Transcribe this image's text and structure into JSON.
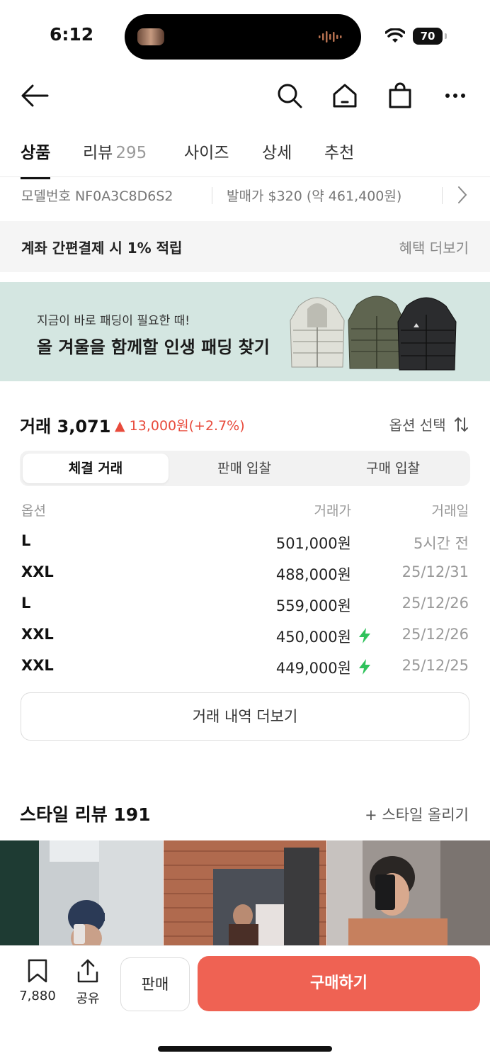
{
  "status": {
    "time": "6:12",
    "battery": "70"
  },
  "tabs": [
    {
      "label": "상품"
    },
    {
      "label": "리뷰",
      "count": "295"
    },
    {
      "label": "사이즈"
    },
    {
      "label": "상세"
    },
    {
      "label": "추천"
    }
  ],
  "model": {
    "number": "모델번호 NF0A3C8D6S2",
    "release": "발매가 $320 (약 461,400원)"
  },
  "benefit": {
    "text": "계좌 간편결제 시 1% 적립",
    "more": "혜택 더보기"
  },
  "banner": {
    "sub": "지금이 바로 패딩이 필요한 때!",
    "main": "올 겨울을 함께할 인생 패딩 찾기"
  },
  "trade": {
    "title": "거래 3,071",
    "change": "▲ 13,000원(+2.7%)",
    "option_select": "옵션 선택",
    "segments": [
      "체결 거래",
      "판매 입찰",
      "구매 입찰"
    ],
    "columns": [
      "옵션",
      "거래가",
      "거래일"
    ],
    "rows": [
      {
        "option": "L",
        "price": "501,000원",
        "date": "5시간 전",
        "quick": false
      },
      {
        "option": "XXL",
        "price": "488,000원",
        "date": "25/12/31",
        "quick": false
      },
      {
        "option": "L",
        "price": "559,000원",
        "date": "25/12/26",
        "quick": false
      },
      {
        "option": "XXL",
        "price": "450,000원",
        "date": "25/12/26",
        "quick": true
      },
      {
        "option": "XXL",
        "price": "449,000원",
        "date": "25/12/25",
        "quick": true
      }
    ],
    "more_label": "거래 내역 더보기"
  },
  "style_review": {
    "title": "스타일 리뷰 191",
    "upload": "+ 스타일 올리기"
  },
  "bottom": {
    "save_count": "7,880",
    "share": "공유",
    "sell": "판매",
    "buy": "구매하기"
  },
  "colors": {
    "accent": "#ef6253",
    "up": "#e84b3c",
    "bolt": "#2fc25b",
    "banner_bg": "#d4e6e1"
  }
}
